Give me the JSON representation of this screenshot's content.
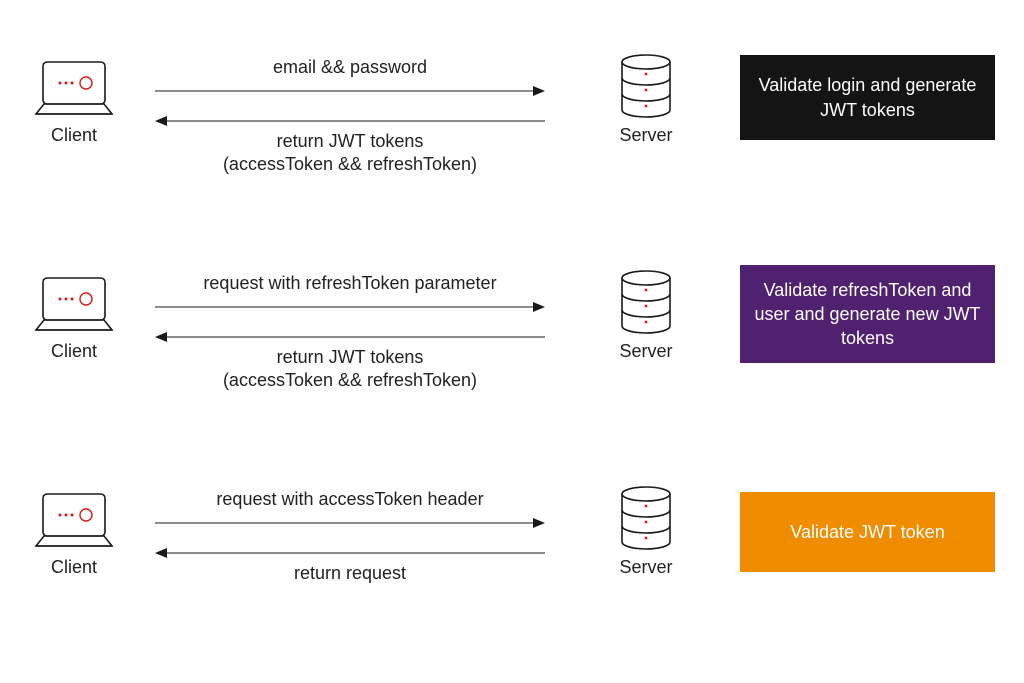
{
  "colors": {
    "box1_bg": "#141414",
    "box2_bg": "#4f216f",
    "box3_bg": "#f08c00",
    "accent_red": "#d11a1a",
    "line": "#1a1a1a"
  },
  "flows": [
    {
      "client_label": "Client",
      "server_label": "Server",
      "request_label": "email && password",
      "response_label": "return JWT tokens\n(accessToken && refreshToken)",
      "box_label": "Validate login and\ngenerate JWT tokens",
      "box_color_key": "box1_bg"
    },
    {
      "client_label": "Client",
      "server_label": "Server",
      "request_label": "request with refreshToken parameter",
      "response_label": "return JWT tokens\n(accessToken && refreshToken)",
      "box_label": "Validate refreshToken\nand user and generate\nnew JWT tokens",
      "box_color_key": "box2_bg"
    },
    {
      "client_label": "Client",
      "server_label": "Server",
      "request_label": "request with accessToken header",
      "response_label": "return request",
      "box_label": "Validate JWT token",
      "box_color_key": "box3_bg"
    }
  ]
}
